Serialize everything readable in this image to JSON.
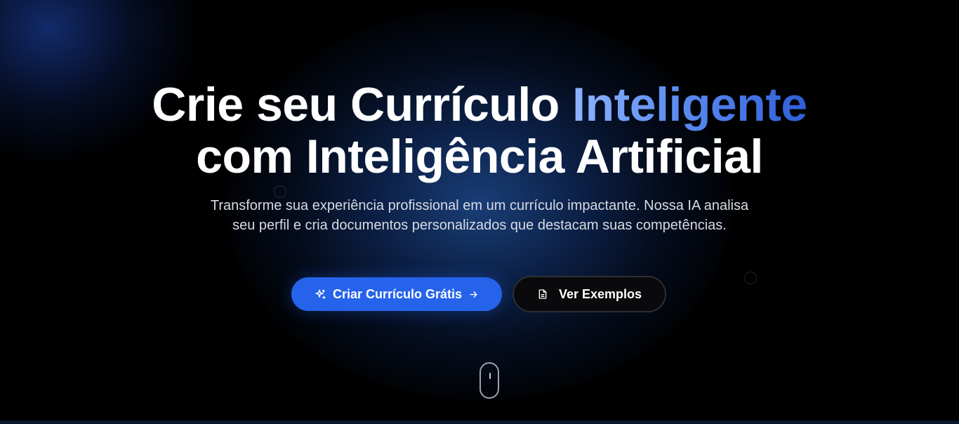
{
  "hero": {
    "headline": {
      "part1": "Crie seu Currículo ",
      "accent": "Inteligente",
      "line2": "com Inteligência Artificial"
    },
    "subtitle": "Transforme sua experiência profissional em um currículo impactante. Nossa IA analisa seu perfil e cria documentos personalizados que destacam suas competências.",
    "primary_button": {
      "label": "Criar Currículo Grátis",
      "icon_left": "sparkles-icon",
      "icon_right": "arrow-right-icon"
    },
    "secondary_button": {
      "label": "Ver Exemplos",
      "icon_left": "document-icon"
    },
    "scroll_indicator": {
      "icon": "mouse-scroll-icon"
    }
  },
  "colors": {
    "background": "#000000",
    "primary": "#2563eb",
    "accent_gradient_start": "#8fb4ff",
    "accent_gradient_end": "#2f5fd8",
    "text": "#ffffff",
    "subtext": "#d6dbe4",
    "glow": "#2558aa"
  }
}
